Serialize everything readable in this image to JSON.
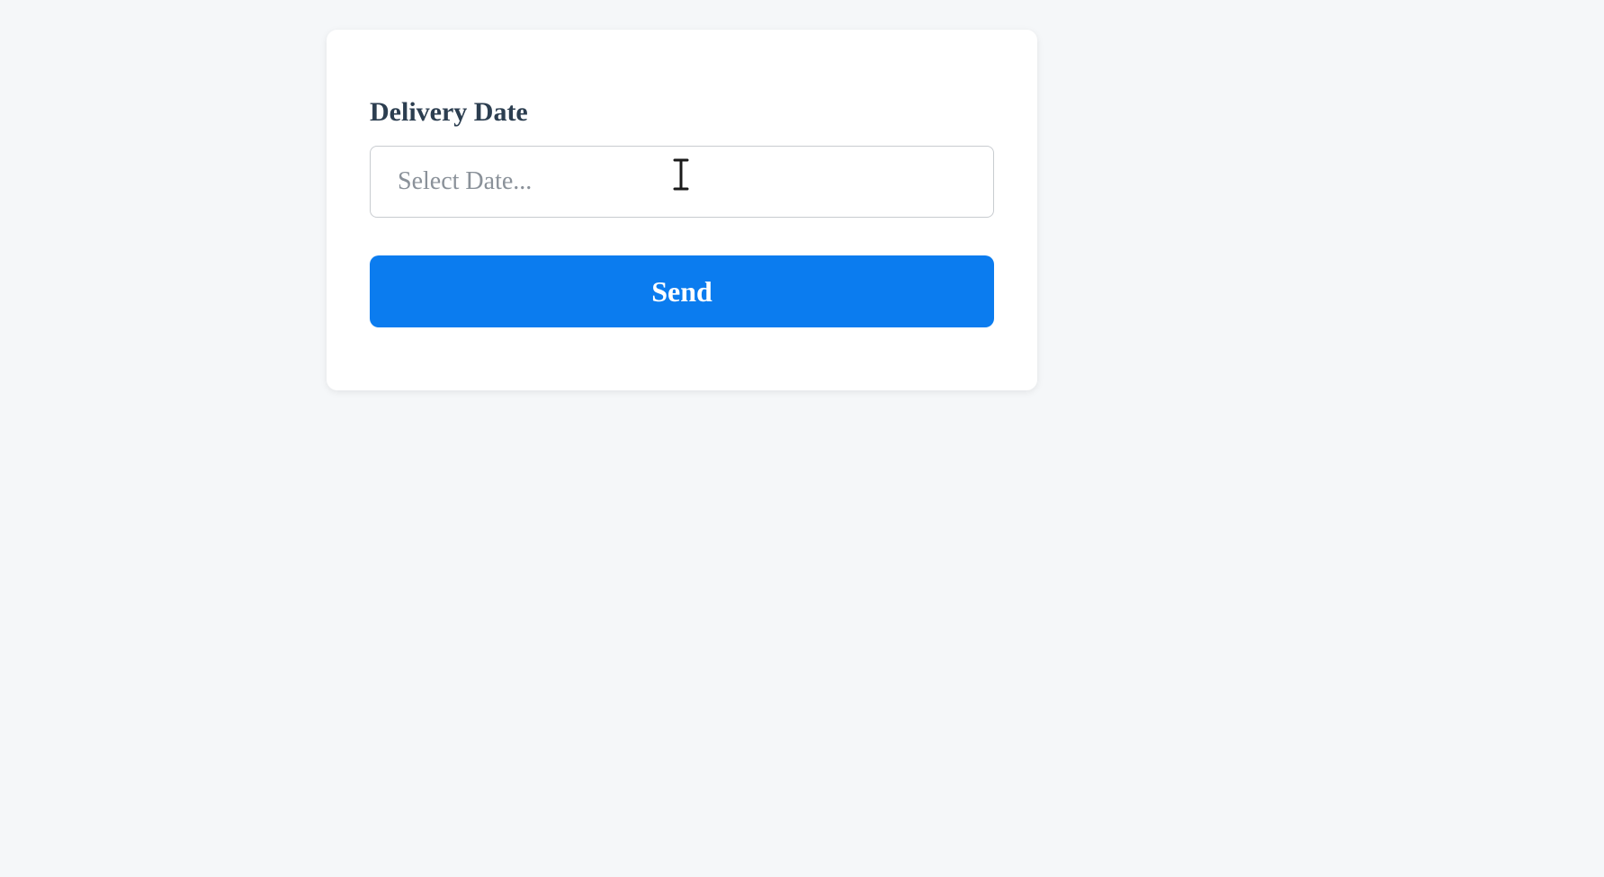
{
  "form": {
    "label": "Delivery Date",
    "placeholder": "Select Date...",
    "value": "",
    "button_label": "Send"
  }
}
